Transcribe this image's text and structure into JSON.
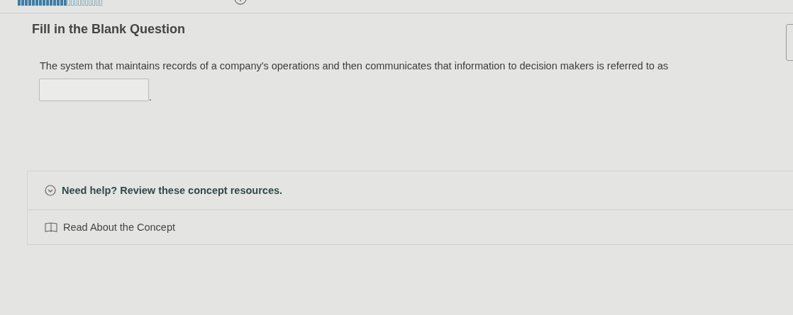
{
  "progress": {
    "level": 0.62
  },
  "question": {
    "title": "Fill in the Blank Question",
    "prompt": "The system that maintains records of a company's operations and then communicates that information to decision makers is referred to as",
    "after_blank": "."
  },
  "help": {
    "title": "Need help? Review these concept resources.",
    "expanded": true,
    "links": [
      "Read About the Concept"
    ]
  }
}
